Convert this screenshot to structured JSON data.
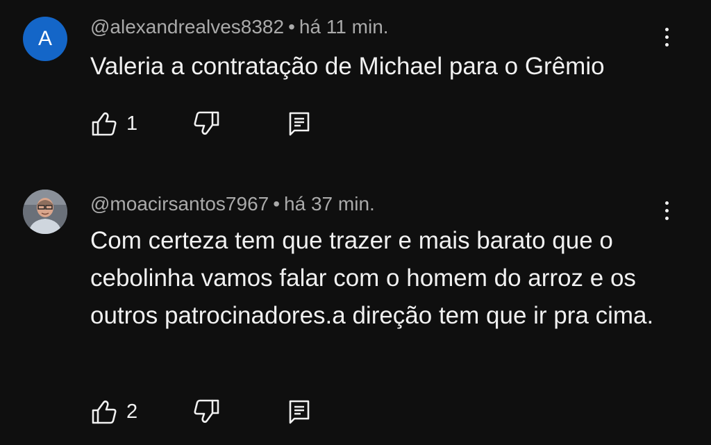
{
  "comments": [
    {
      "avatar_letter": "A",
      "avatar_color": "#1466c8",
      "author": "@alexandrealves8382",
      "separator": "•",
      "time": "há 11 min.",
      "text": "Valeria a contratação de Michael para o Grêmio",
      "likes": "1",
      "icons": {
        "like": "thumb-up-icon",
        "dislike": "thumb-down-icon",
        "reply": "reply-comment-icon",
        "more": "more-vert-icon"
      }
    },
    {
      "avatar_letter": "",
      "author": "@moacirsantos7967",
      "separator": "•",
      "time": "há 37 min.",
      "text": "Com certeza tem que trazer e mais barato que o cebolinha vamos falar com o homem do arroz e os outros patrocinadores.a direção tem que ir pra cima.",
      "likes": "2",
      "icons": {
        "like": "thumb-up-icon",
        "dislike": "thumb-down-icon",
        "reply": "reply-comment-icon",
        "more": "more-vert-icon"
      }
    }
  ],
  "colors": {
    "background": "#0f0f0f",
    "text": "#f1f1f1",
    "meta": "#aaaaaa"
  }
}
